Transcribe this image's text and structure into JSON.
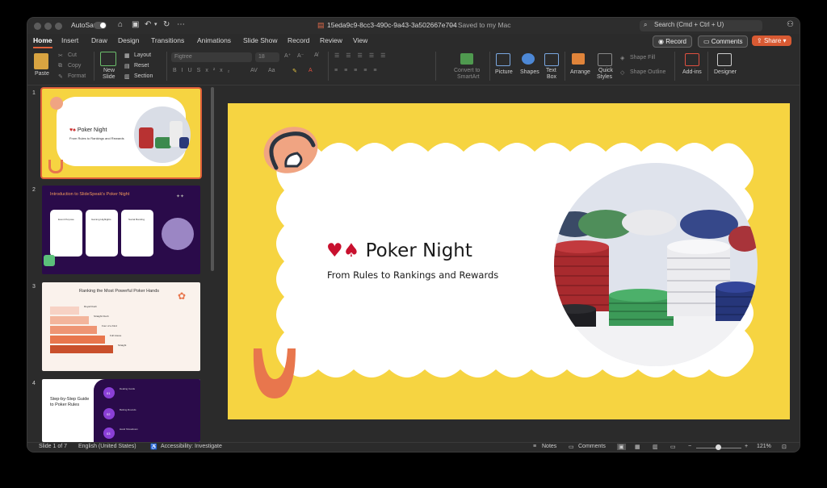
{
  "titlebar": {
    "autosave_label": "AutoSave",
    "document_name": "15eda9c9-8cc3-490c-9a43-3a502667e704",
    "save_status": "— Saved to my Mac",
    "search_placeholder": "Search (Cmd + Ctrl + U)"
  },
  "tabs": [
    "Home",
    "Insert",
    "Draw",
    "Design",
    "Transitions",
    "Animations",
    "Slide Show",
    "Record",
    "Review",
    "View"
  ],
  "actions": {
    "record": "Record",
    "comments": "Comments",
    "share": "Share"
  },
  "ribbon": {
    "paste": "Paste",
    "cut": "Cut",
    "copy": "Copy",
    "format": "Format",
    "new_slide_1": "New",
    "new_slide_2": "Slide",
    "layout": "Layout",
    "reset": "Reset",
    "section": "Section",
    "font_name": "Figtree",
    "font_size": "18",
    "convert_smartart_1": "Convert to",
    "convert_smartart_2": "SmartArt",
    "picture": "Picture",
    "shapes": "Shapes",
    "text_box_1": "Text",
    "text_box_2": "Box",
    "arrange": "Arrange",
    "quick_styles_1": "Quick",
    "quick_styles_2": "Styles",
    "shape_fill": "Shape Fill",
    "shape_outline": "Shape Outline",
    "add_ins": "Add-ins",
    "designer": "Designer"
  },
  "thumbnails": [
    {
      "number": "1",
      "title": "Poker Night",
      "subtitle": "From Rules to Rankings and Rewards"
    },
    {
      "number": "2",
      "title": "Introduction to SlideSpeak's Poker Night",
      "cards": [
        "Event Purpose",
        "Gaming Highlights",
        "Social Bonding"
      ]
    },
    {
      "number": "3",
      "title": "Ranking the Most Powerful Poker Hands",
      "hands": [
        "Royal Flush",
        "Straight Flush",
        "Four of a Kind",
        "Full House",
        "Straight"
      ]
    },
    {
      "number": "4",
      "title": "Step-by-Step Guide to Poker Rules",
      "steps": [
        "01",
        "02",
        "03"
      ],
      "step_titles": [
        "Dealing Cards",
        "Betting Rounds",
        "Hand Showdown"
      ]
    }
  ],
  "slide": {
    "title": "Poker Night",
    "subtitle": "From Rules to Rankings and Rewards",
    "suits": "♥♠"
  },
  "status": {
    "slide_indicator": "Slide 1 of 7",
    "language": "English (United States)",
    "accessibility": "Accessibility: Investigate",
    "notes": "Notes",
    "comments": "Comments",
    "zoom": "121%"
  },
  "colors": {
    "accent": "#e0603a",
    "slide_bg": "#f6d441",
    "dark_slide": "#2a0b4a",
    "peach": "#f0a482",
    "orange": "#e8764d"
  }
}
